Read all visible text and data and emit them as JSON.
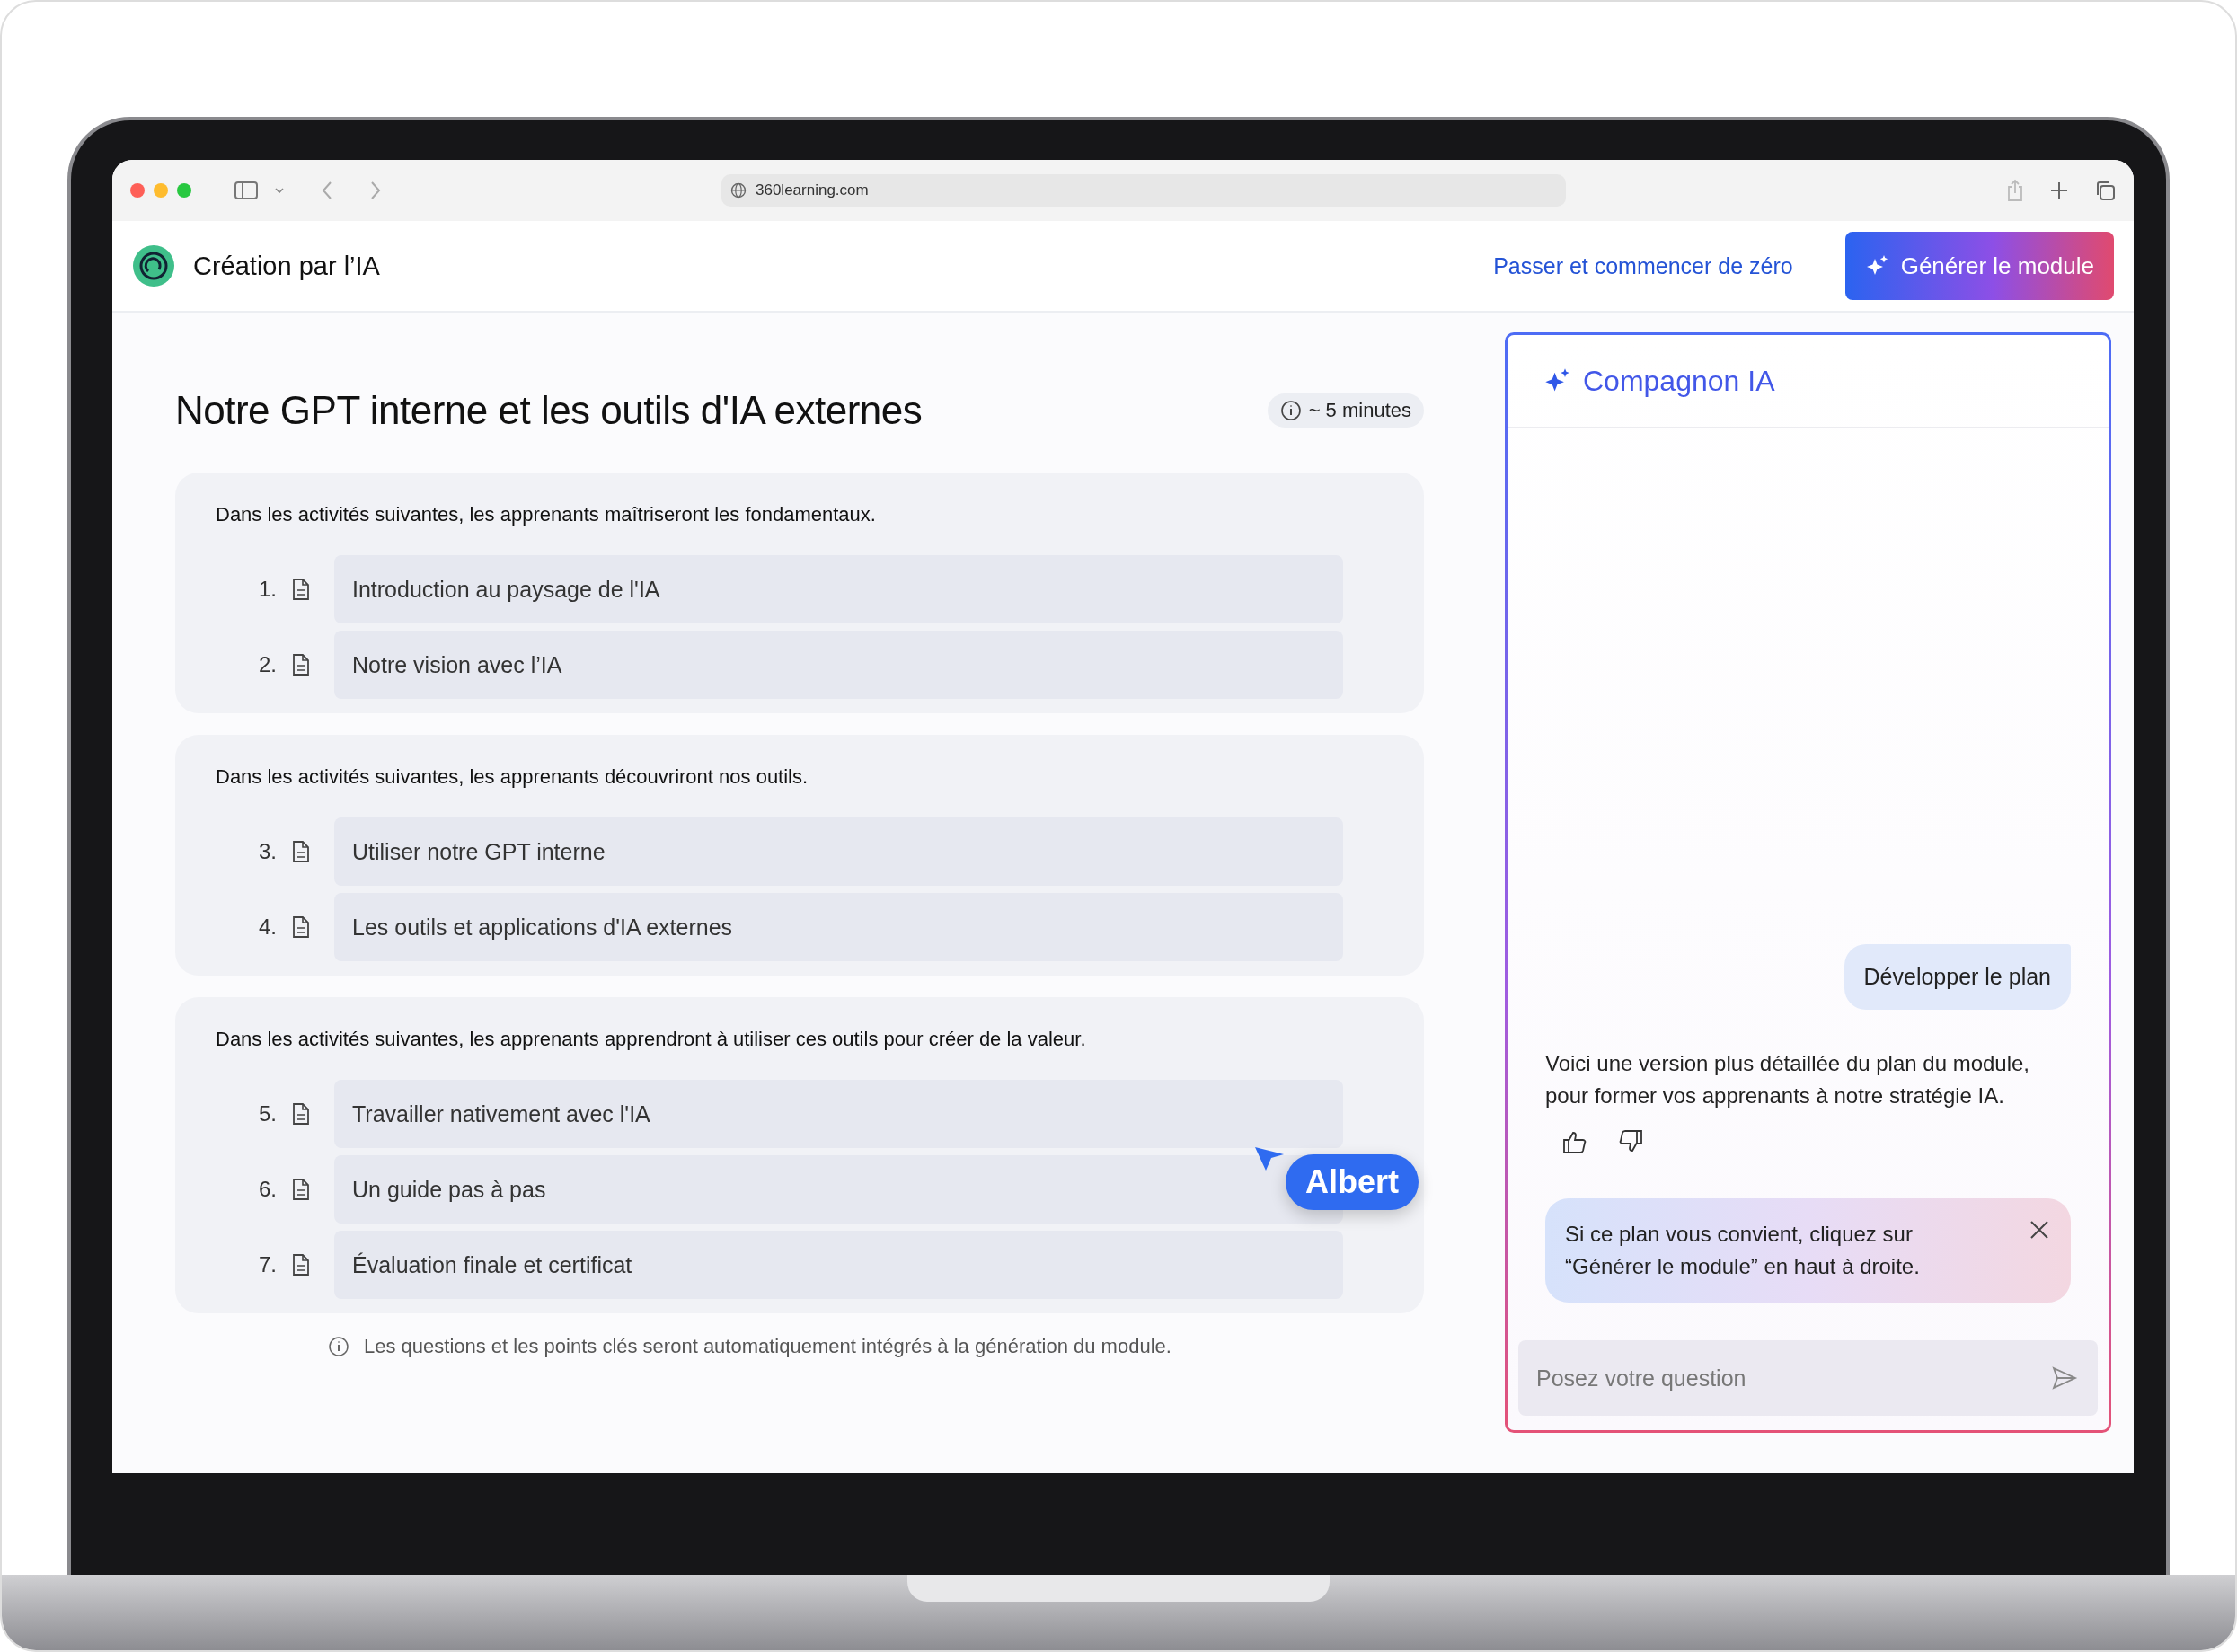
{
  "browser": {
    "url": "360learning.com"
  },
  "header": {
    "title": "Création par l’IA",
    "skip_link": "Passer et commencer de zéro",
    "generate_button": "Générer le module"
  },
  "module": {
    "title": "Notre GPT interne et les outils d'IA externes",
    "duration": "~ 5 minutes",
    "sections": [
      {
        "intro": "Dans les activités suivantes, les apprenants maîtriseront les fondamentaux.",
        "activities": [
          {
            "number": "1.",
            "title": "Introduction au paysage de l'IA"
          },
          {
            "number": "2.",
            "title": "Notre vision avec l’IA"
          }
        ]
      },
      {
        "intro": "Dans les activités suivantes, les apprenants découvriront nos outils.",
        "activities": [
          {
            "number": "3.",
            "title": "Utiliser notre GPT interne"
          },
          {
            "number": "4.",
            "title": "Les outils et applications d'IA externes"
          }
        ]
      },
      {
        "intro": "Dans les activités suivantes, les apprenants apprendront à utiliser ces outils pour créer de la valeur.",
        "activities": [
          {
            "number": "5.",
            "title": "Travailler nativement avec l'IA"
          },
          {
            "number": "6.",
            "title": "Un guide pas à pas"
          },
          {
            "number": "7.",
            "title": "Évaluation finale et certificat"
          }
        ]
      }
    ],
    "note": "Les questions et les points clés seront automatiquement intégrés à la génération du module."
  },
  "cursor": {
    "label": "Albert"
  },
  "assistant": {
    "title": "Compagnon IA",
    "messages": [
      {
        "kind": "user",
        "text": "Développer le plan"
      },
      {
        "kind": "assistant",
        "text": "Voici une version plus détaillée du plan du module, pour former vos apprenants à notre stratégie IA."
      }
    ],
    "tip": "Si ce plan vous convient, cliquez sur “Générer le module” en haut à droite.",
    "input": {
      "placeholder": "Posez votre question"
    }
  }
}
